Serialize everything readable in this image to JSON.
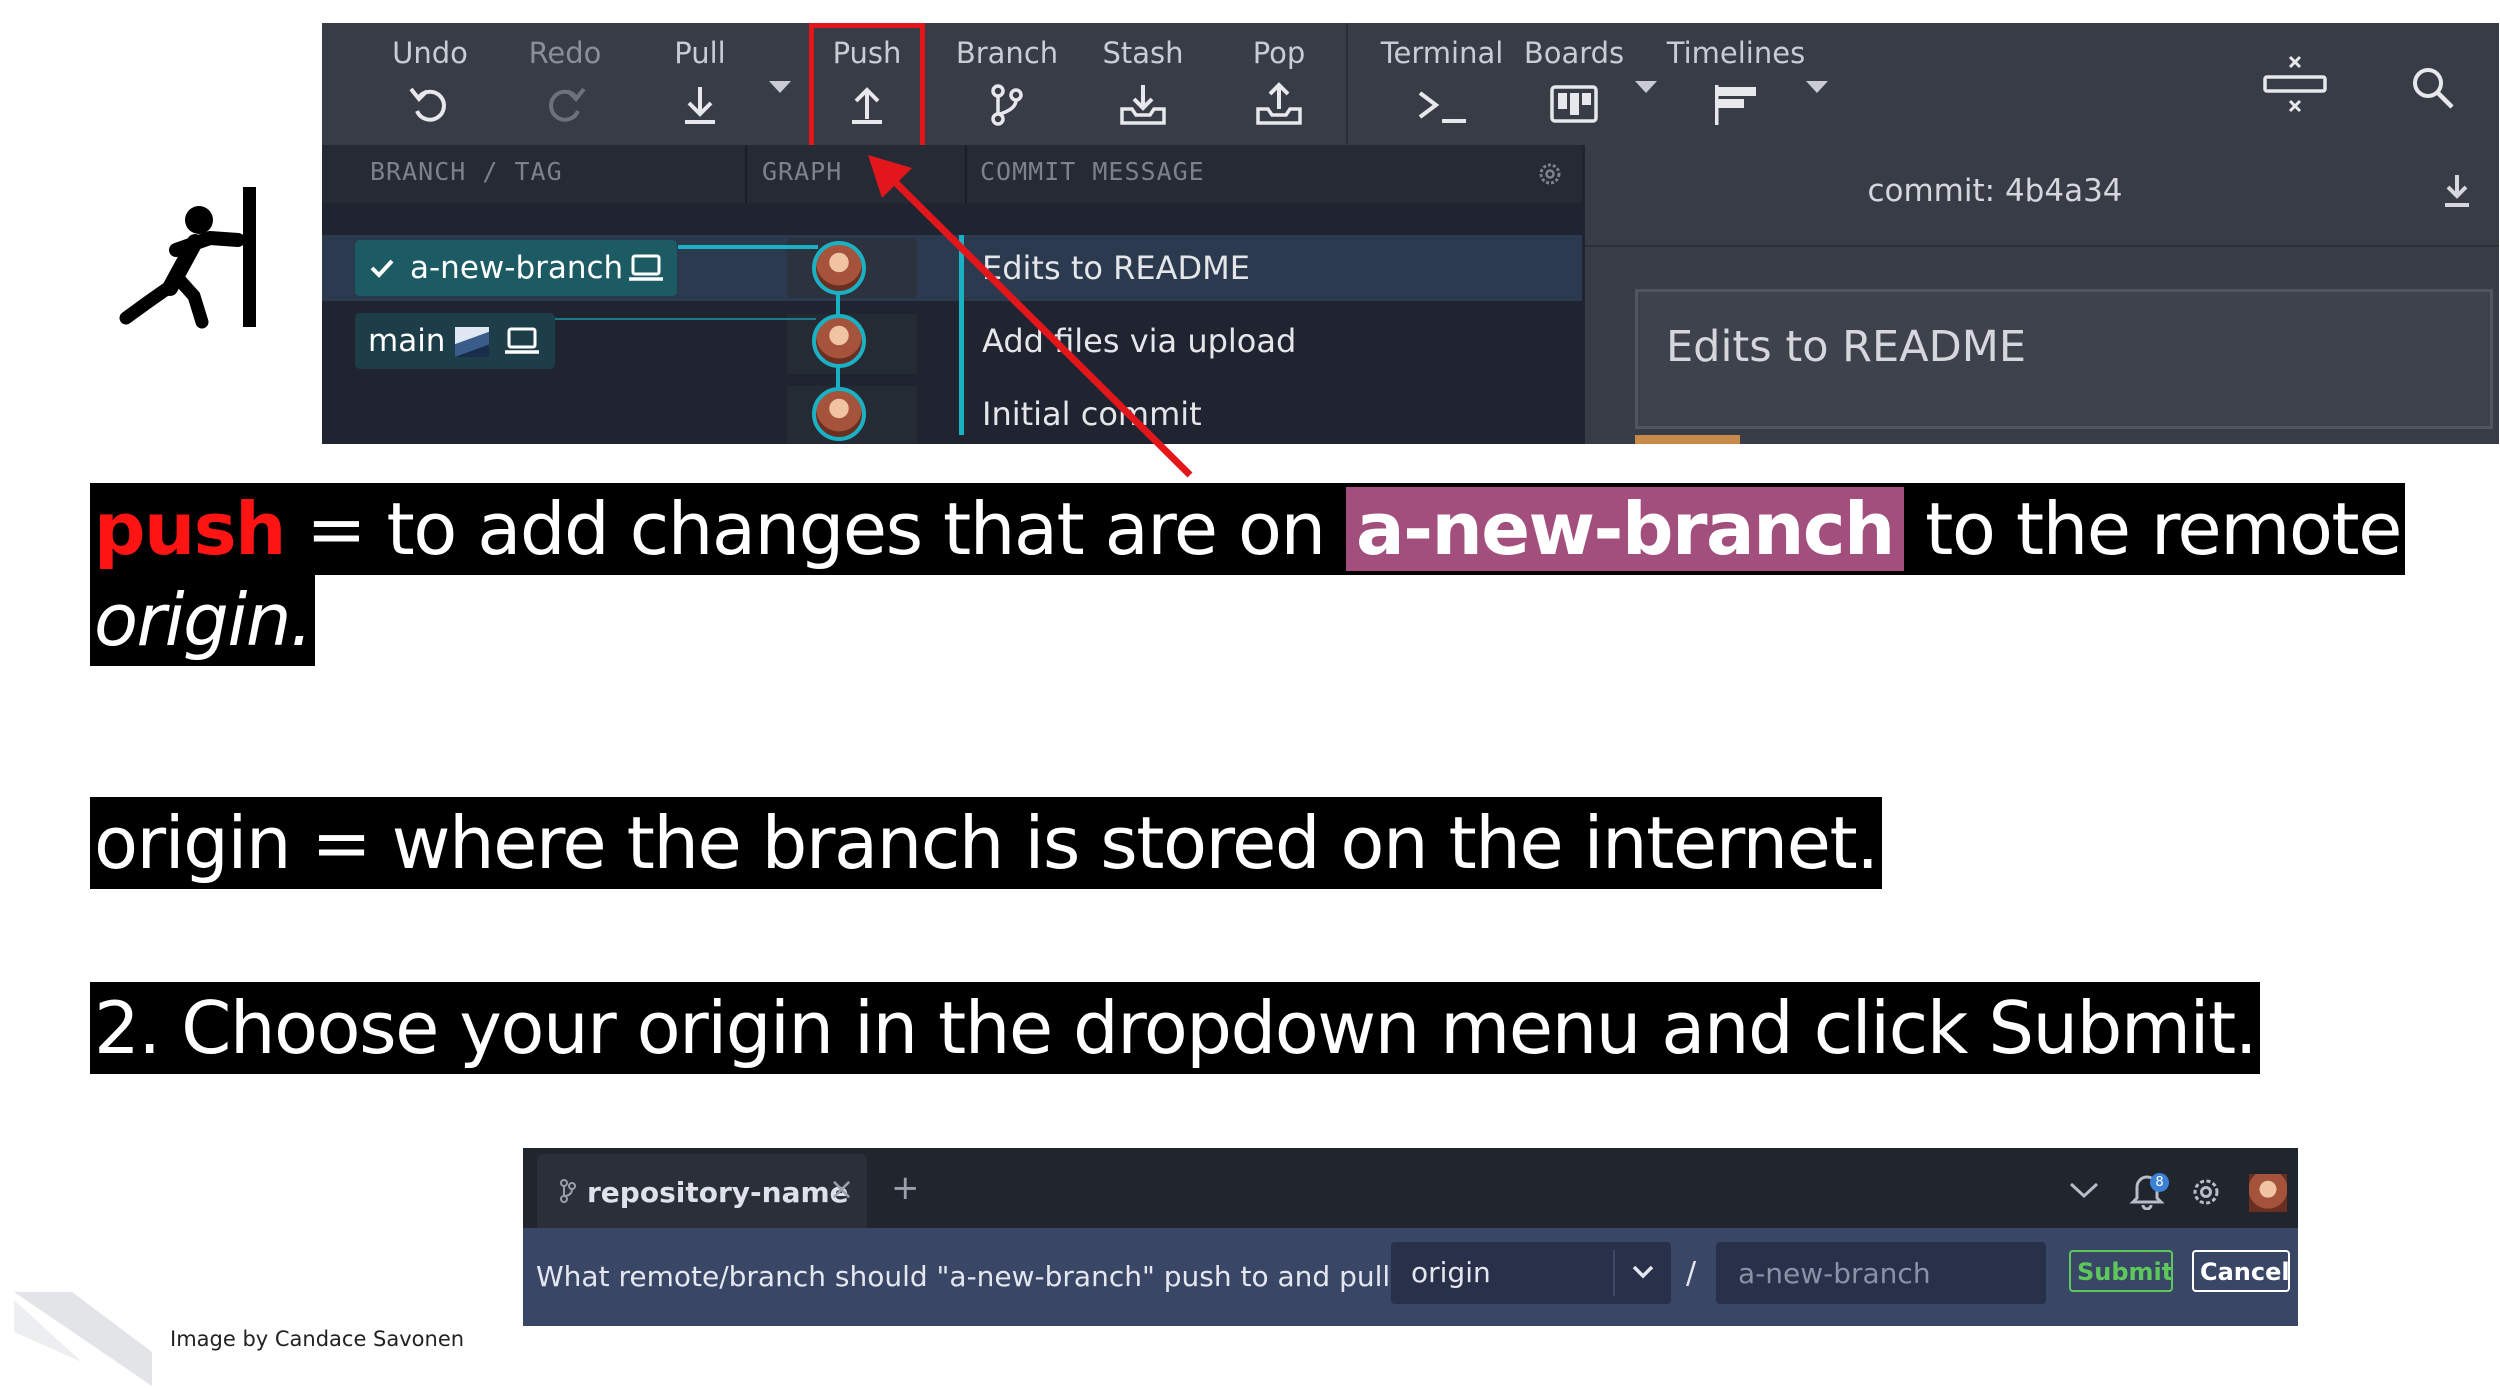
{
  "toolbar": {
    "undo": "Undo",
    "redo": "Redo",
    "pull": "Pull",
    "push": "Push",
    "branch": "Branch",
    "stash": "Stash",
    "pop": "Pop",
    "terminal": "Terminal",
    "boards": "Boards",
    "timelines": "Timelines"
  },
  "columns": {
    "branch_tag": "BRANCH / TAG",
    "graph": "GRAPH",
    "commit_message": "COMMIT MESSAGE"
  },
  "branches": {
    "active": "a-new-branch",
    "other": "main"
  },
  "commits": [
    {
      "message": "Edits to README"
    },
    {
      "message": "Add files via upload"
    },
    {
      "message": "Initial commit"
    }
  ],
  "detail": {
    "commit_label": "commit:",
    "commit_hash": "4b4a34",
    "commit_title": "Edits to README"
  },
  "explanation": {
    "push_word": "push",
    "push_mid": " = to add changes that are on ",
    "branch_word": "a-new-branch",
    "push_end": " to the remote",
    "origin_word": "origin",
    "origin_end": ".",
    "origin_def": "origin = where the branch is stored on the internet.",
    "step2": "2. Choose your origin in the dropdown menu and click Submit."
  },
  "dialog": {
    "tab_name": "repository-name",
    "question": "What remote/branch should \"a-new-branch\" push to and pull from?",
    "remote_value": "origin",
    "slash": "/",
    "branch_placeholder": "a-new-branch",
    "submit": "Submit",
    "cancel": "Cancel",
    "notification_count": "8"
  },
  "credit": "Image by Candace Savonen",
  "colors": {
    "push_red": "#ff1414",
    "branch_pink": "#a24f7d",
    "highlight_red": "#e3171b",
    "teal": "#1bb1c4",
    "submit_green": "#5cc85c"
  }
}
